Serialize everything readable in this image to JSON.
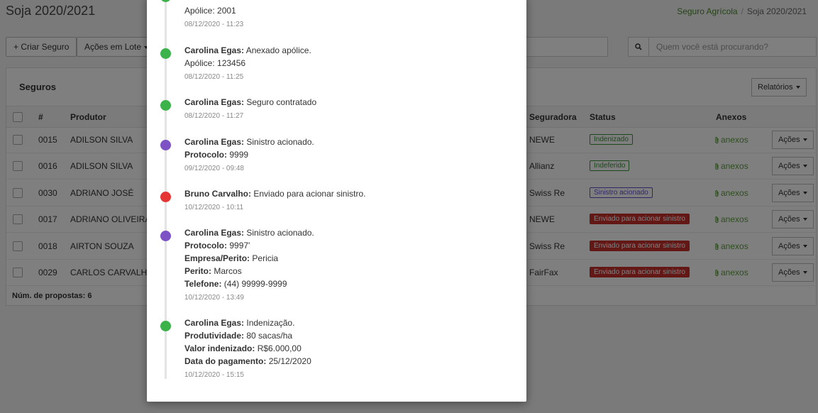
{
  "page": {
    "title": "Soja 2020/2021",
    "breadcrumb": {
      "link": "Seguro Agrícola",
      "separator": "/",
      "current": "Soja 2020/2021"
    }
  },
  "toolbar": {
    "create_label": "+ Criar Seguro",
    "bulk_label": "Ações em Lote",
    "search_placeholder": "Quem você está procurando?"
  },
  "panel": {
    "title": "Seguros",
    "reports_label": "Relatórios",
    "footer": "Núm. de propostas: 6"
  },
  "table": {
    "headers": {
      "num": "#",
      "producer": "Produtor",
      "insurer": "Seguradora",
      "status": "Status",
      "attachments": "Anexos"
    },
    "action_label": "Ações",
    "attach_label": "anexos",
    "rows": [
      {
        "num": "0015",
        "producer": "ADILSON SILVA",
        "insurer": "NEWE",
        "status": "Indenizado",
        "status_type": "green"
      },
      {
        "num": "0016",
        "producer": "ADILSON SILVA",
        "insurer": "Allianz",
        "status": "Indeferido",
        "status_type": "green"
      },
      {
        "num": "0030",
        "producer": "ADRIANO JOSÉ",
        "insurer": "Swiss Re",
        "status": "Sinistro acionado",
        "status_type": "purple"
      },
      {
        "num": "0017",
        "producer": "ADRIANO OLIVEIRA",
        "insurer": "NEWE",
        "status": "Enviado para acionar sinistro",
        "status_type": "red"
      },
      {
        "num": "0018",
        "producer": "AIRTON SOUZA",
        "insurer": "Swiss Re",
        "status": "Enviado para acionar sinistro",
        "status_type": "red"
      },
      {
        "num": "0029",
        "producer": "CARLOS CARVALHO",
        "insurer": "FairFax",
        "status": "Enviado para acionar sinistro",
        "status_type": "red"
      }
    ]
  },
  "timeline": {
    "events": [
      {
        "color": "green",
        "lines": [
          {
            "label": "",
            "text": "Apólice: 2001"
          }
        ],
        "time": "08/12/2020 - 11:23"
      },
      {
        "color": "green",
        "lines": [
          {
            "label": "Carolina Egas:",
            "text": "Anexado apólice."
          },
          {
            "label": "",
            "text": "Apólice: 123456"
          }
        ],
        "time": "08/12/2020 - 11:25"
      },
      {
        "color": "green",
        "lines": [
          {
            "label": "Carolina Egas:",
            "text": "Seguro contratado"
          }
        ],
        "time": "08/12/2020 - 11:27"
      },
      {
        "color": "purple",
        "lines": [
          {
            "label": "Carolina Egas:",
            "text": "Sinistro acionado."
          },
          {
            "label": "Protocolo:",
            "text": "9999"
          }
        ],
        "time": "09/12/2020 - 09:48"
      },
      {
        "color": "red",
        "lines": [
          {
            "label": "Bruno Carvalho:",
            "text": "Enviado para acionar sinistro."
          }
        ],
        "time": "10/12/2020 - 10:11"
      },
      {
        "color": "purple",
        "lines": [
          {
            "label": "Carolina Egas:",
            "text": "Sinistro acionado."
          },
          {
            "label": "Protocolo:",
            "text": "9997'"
          },
          {
            "label": "Empresa/Perito:",
            "text": "Pericia"
          },
          {
            "label": "Perito:",
            "text": "Marcos"
          },
          {
            "label": "Telefone:",
            "text": "(44) 99999-9999"
          }
        ],
        "time": "10/12/2020 - 13:49"
      },
      {
        "color": "green",
        "lines": [
          {
            "label": "Carolina Egas:",
            "text": "Indenização."
          },
          {
            "label": "Produtividade:",
            "text": "80 sacas/ha"
          },
          {
            "label": "Valor indenizado:",
            "text": "R$6.000,00"
          },
          {
            "label": "Data do pagamento:",
            "text": "25/12/2020"
          }
        ],
        "time": "10/12/2020 - 15:15"
      }
    ]
  }
}
